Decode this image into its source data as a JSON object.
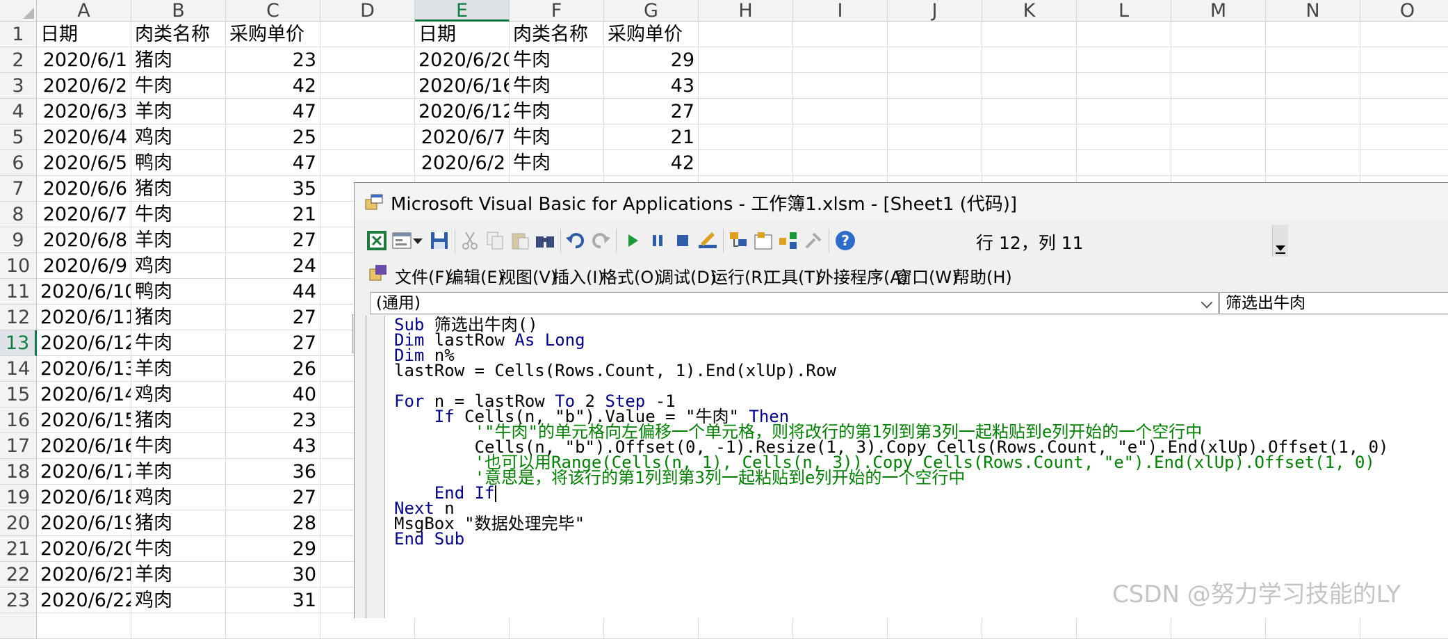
{
  "sheet": {
    "columns": [
      "A",
      "B",
      "C",
      "D",
      "E",
      "F",
      "G",
      "H",
      "I",
      "J",
      "K",
      "L",
      "M",
      "N",
      "O"
    ],
    "selected_column": "E",
    "selected_row": "13",
    "table_a": {
      "headers": [
        "日期",
        "肉类名称",
        "采购单价"
      ],
      "rows": [
        [
          "2020/6/1",
          "猪肉",
          "23"
        ],
        [
          "2020/6/2",
          "牛肉",
          "42"
        ],
        [
          "2020/6/3",
          "羊肉",
          "47"
        ],
        [
          "2020/6/4",
          "鸡肉",
          "25"
        ],
        [
          "2020/6/5",
          "鸭肉",
          "47"
        ],
        [
          "2020/6/6",
          "猪肉",
          "35"
        ],
        [
          "2020/6/7",
          "牛肉",
          "21"
        ],
        [
          "2020/6/8",
          "羊肉",
          "27"
        ],
        [
          "2020/6/9",
          "鸡肉",
          "24"
        ],
        [
          "2020/6/10",
          "鸭肉",
          "44"
        ],
        [
          "2020/6/11",
          "猪肉",
          "27"
        ],
        [
          "2020/6/12",
          "牛肉",
          "27"
        ],
        [
          "2020/6/13",
          "羊肉",
          "26"
        ],
        [
          "2020/6/14",
          "鸡肉",
          "40"
        ],
        [
          "2020/6/15",
          "猪肉",
          "23"
        ],
        [
          "2020/6/16",
          "牛肉",
          "43"
        ],
        [
          "2020/6/17",
          "羊肉",
          "36"
        ],
        [
          "2020/6/18",
          "鸡肉",
          "27"
        ],
        [
          "2020/6/19",
          "猪肉",
          "28"
        ],
        [
          "2020/6/20",
          "牛肉",
          "29"
        ],
        [
          "2020/6/21",
          "羊肉",
          "30"
        ],
        [
          "2020/6/22",
          "鸡肉",
          "31"
        ]
      ]
    },
    "table_e": {
      "headers": [
        "日期",
        "肉类名称",
        "采购单价"
      ],
      "rows": [
        [
          "2020/6/20",
          "牛肉",
          "29"
        ],
        [
          "2020/6/16",
          "牛肉",
          "43"
        ],
        [
          "2020/6/12",
          "牛肉",
          "27"
        ],
        [
          "2020/6/7",
          "牛肉",
          "21"
        ],
        [
          "2020/6/2",
          "牛肉",
          "42"
        ]
      ]
    }
  },
  "vba": {
    "title": "Microsoft Visual Basic for Applications - 工作簿1.xlsm - [Sheet1 (代码)]",
    "toolbar": {
      "icons": [
        "excel-icon",
        "insert-userform-icon",
        "dropdown-arrow-icon",
        "save-icon",
        "cut-icon",
        "copy-icon",
        "paste-icon",
        "find-icon",
        "undo-icon",
        "redo-icon",
        "run-icon",
        "pause-icon",
        "stop-icon",
        "design-mode-icon",
        "project-explorer-icon",
        "properties-icon",
        "object-browser-icon",
        "toolbox-icon",
        "help-icon"
      ],
      "position": "行 12，列 11"
    },
    "menus": [
      "文件(F)",
      "编辑(E)",
      "视图(V)",
      "插入(I)",
      "格式(O)",
      "调试(D)",
      "运行(R)",
      "工具(T)",
      "外接程序(A)",
      "窗口(W)",
      "帮助(H)"
    ],
    "object_box": "(通用)",
    "procedure_box": "筛选出牛肉",
    "code_lines": [
      [
        {
          "t": "Sub ",
          "k": "kw"
        },
        {
          "t": "筛选出牛肉()",
          "k": ""
        }
      ],
      [
        {
          "t": "Dim ",
          "k": "kw"
        },
        {
          "t": "lastRow ",
          "k": ""
        },
        {
          "t": "As Long",
          "k": "kw"
        }
      ],
      [
        {
          "t": "Dim ",
          "k": "kw"
        },
        {
          "t": "n%",
          "k": ""
        }
      ],
      [
        {
          "t": "lastRow = Cells(Rows.Count, 1).End(xlUp).Row",
          "k": ""
        }
      ],
      [],
      [
        {
          "t": "For ",
          "k": "kw"
        },
        {
          "t": "n = lastRow ",
          "k": ""
        },
        {
          "t": "To ",
          "k": "kw"
        },
        {
          "t": "2 ",
          "k": ""
        },
        {
          "t": "Step ",
          "k": "kw"
        },
        {
          "t": "-1",
          "k": ""
        }
      ],
      [
        {
          "t": "    If ",
          "k": "kw"
        },
        {
          "t": "Cells(n, \"b\").Value = \"牛肉\" ",
          "k": ""
        },
        {
          "t": "Then",
          "k": "kw"
        }
      ],
      [
        {
          "t": "        '\"牛肉\"的单元格向左偏移一个单元格，则将改行的第1列到第3列一起粘贴到e列开始的一个空行中",
          "k": "cm"
        }
      ],
      [
        {
          "t": "        Cells(n, \"b\").Offset(0, -1).Resize(1, 3).Copy Cells(Rows.Count, \"e\").End(xlUp).Offset(1, 0)",
          "k": ""
        }
      ],
      [
        {
          "t": "        '也可以用Range(Cells(n, 1), Cells(n, 3)).Copy Cells(Rows.Count, \"e\").End(xlUp).Offset(1, 0)",
          "k": "cm"
        }
      ],
      [
        {
          "t": "        '意思是，将该行的第1列到第3列一起粘贴到e列开始的一个空行中",
          "k": "cm"
        }
      ],
      [
        {
          "t": "    End If",
          "k": "kw"
        },
        {
          "t": "",
          "k": "caret"
        }
      ],
      [
        {
          "t": "Next ",
          "k": "kw"
        },
        {
          "t": "n",
          "k": ""
        }
      ],
      [
        {
          "t": "MsgBox \"数据处理完毕\"",
          "k": ""
        }
      ],
      [
        {
          "t": "End Sub",
          "k": "kw"
        }
      ]
    ]
  },
  "watermark": "CSDN @努力学习技能的LY",
  "colors": {
    "keyword": "#00008b",
    "comment": "#008000",
    "selection_green": "#107c41"
  }
}
